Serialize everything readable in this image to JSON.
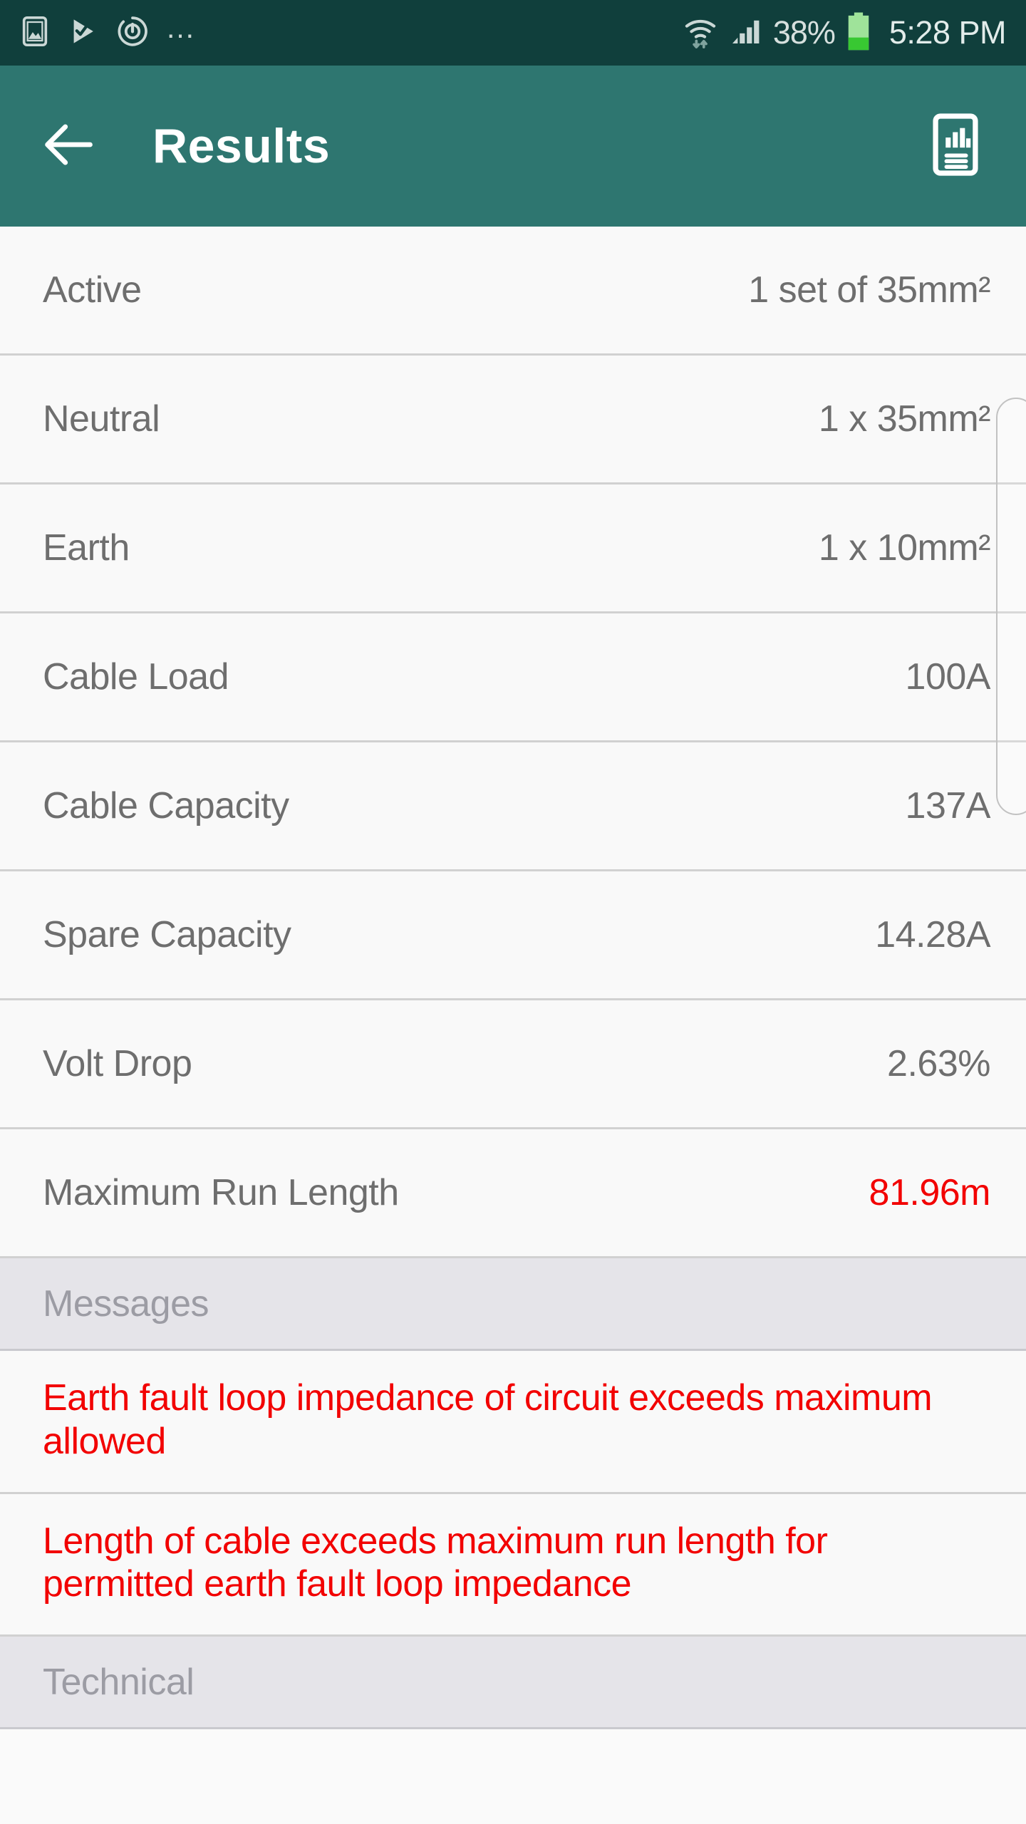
{
  "statusbar": {
    "icons": [
      "screenshot-icon",
      "play-check-icon",
      "power-restart-icon"
    ],
    "overflow": "…",
    "battery_percent": "38%",
    "time": "5:28 PM",
    "battery_color": "#38C832",
    "wifi_icon": "wifi-icon",
    "signal_icon": "signal-bars-icon",
    "battery_icon": "battery-icon"
  },
  "appbar": {
    "back_icon": "back-arrow-icon",
    "title": "Results",
    "report_icon": "report-document-icon"
  },
  "results": {
    "rows": [
      {
        "label": "Active",
        "value": "1 set of 35mm²",
        "alert": false
      },
      {
        "label": "Neutral",
        "value": "1 x 35mm²",
        "alert": false
      },
      {
        "label": "Earth",
        "value": "1 x 10mm²",
        "alert": false
      },
      {
        "label": "Cable Load",
        "value": "100A",
        "alert": false
      },
      {
        "label": "Cable Capacity",
        "value": "137A",
        "alert": false
      },
      {
        "label": "Spare Capacity",
        "value": "14.28A",
        "alert": false
      },
      {
        "label": "Volt Drop",
        "value": "2.63%",
        "alert": false
      },
      {
        "label": "Maximum Run Length",
        "value": "81.96m",
        "alert": true
      }
    ]
  },
  "messages_section": {
    "header": "Messages",
    "items": [
      "Earth fault loop impedance of circuit exceeds maximum allowed",
      "Length of cable exceeds maximum run length for permitted earth fault loop impedance"
    ]
  },
  "technical_section": {
    "header": "Technical"
  },
  "colors": {
    "statusbar_bg": "#103F3C",
    "appbar_bg": "#2E7670",
    "row_bg": "#F9F9F9",
    "section_bg": "#E5E4E9",
    "divider": "#D1D1D1",
    "label_text": "#6E6E6E",
    "section_text": "#9C9CA4",
    "alert_text": "#F20000"
  }
}
